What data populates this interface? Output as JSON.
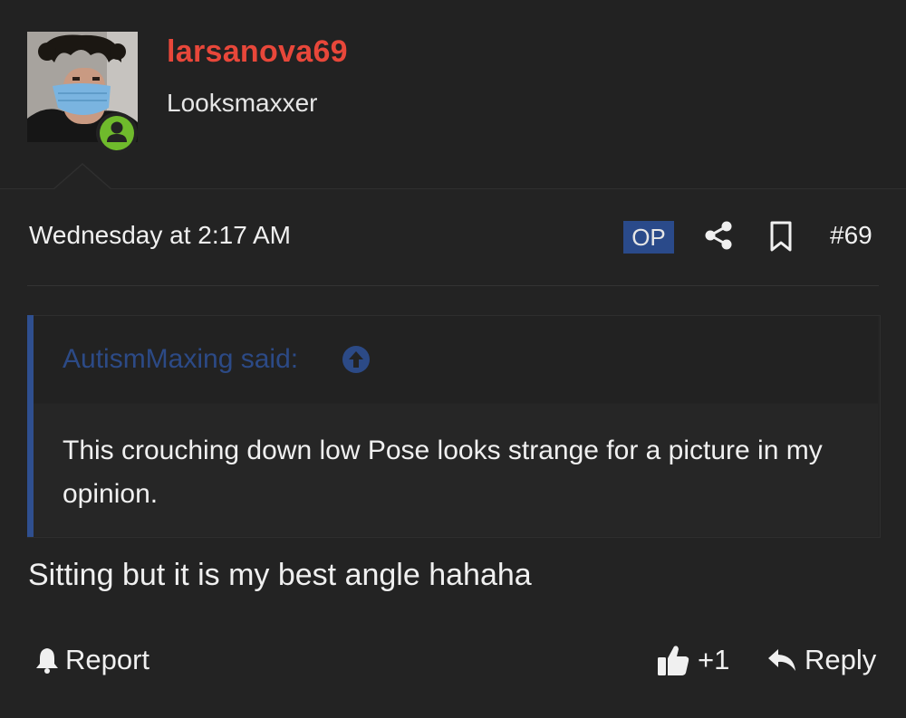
{
  "user": {
    "name": "larsanova69",
    "title": "Looksmaxxer",
    "status": "online",
    "colors": {
      "name": "#e8473a",
      "online": "#6fba2c"
    }
  },
  "meta": {
    "date": "Wednesday at 2:17 AM",
    "op_label": "OP",
    "post_number": "#69",
    "icons": [
      "share-icon",
      "bookmark-icon"
    ]
  },
  "quote": {
    "author_label": "AutismMaxing said:",
    "text": "This crouching down low Pose looks strange for a picture in my opinion.",
    "icon": "arrow-up-circle-icon",
    "accent": "#2f4f8f"
  },
  "body": {
    "text": "Sitting but it is my best angle hahaha"
  },
  "footer": {
    "report_label": "Report",
    "like_count": "+1",
    "reply_label": "Reply"
  }
}
